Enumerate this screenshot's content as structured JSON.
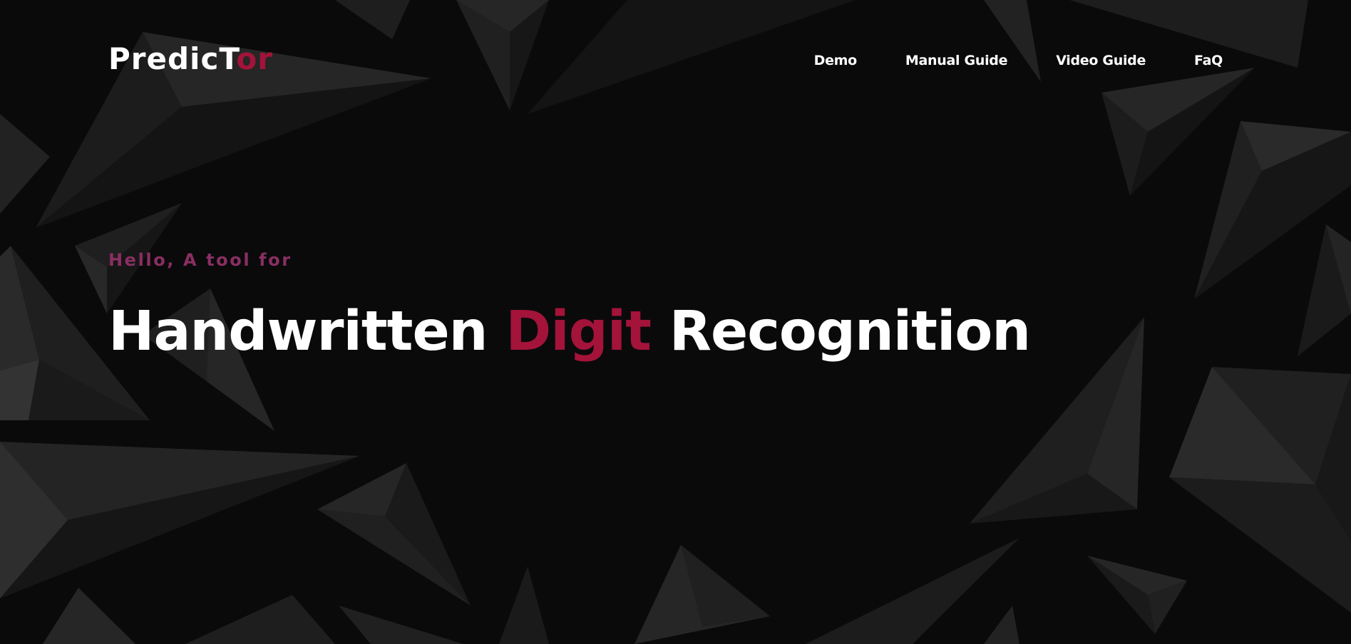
{
  "brand": {
    "logo_main": "PredicT",
    "logo_accent": "or"
  },
  "nav": {
    "items": [
      {
        "label": "Demo"
      },
      {
        "label": "Manual Guide"
      },
      {
        "label": "Video Guide"
      },
      {
        "label": "FaQ"
      }
    ]
  },
  "hero": {
    "eyebrow": "Hello, A tool for",
    "title_part1": "Handwritten",
    "title_accent": "Digit",
    "title_part2": "Recognition"
  },
  "colors": {
    "background": "#0a0a0b",
    "accent": "#a3133a",
    "eyebrow": "#8a2e62",
    "text": "#ffffff"
  }
}
